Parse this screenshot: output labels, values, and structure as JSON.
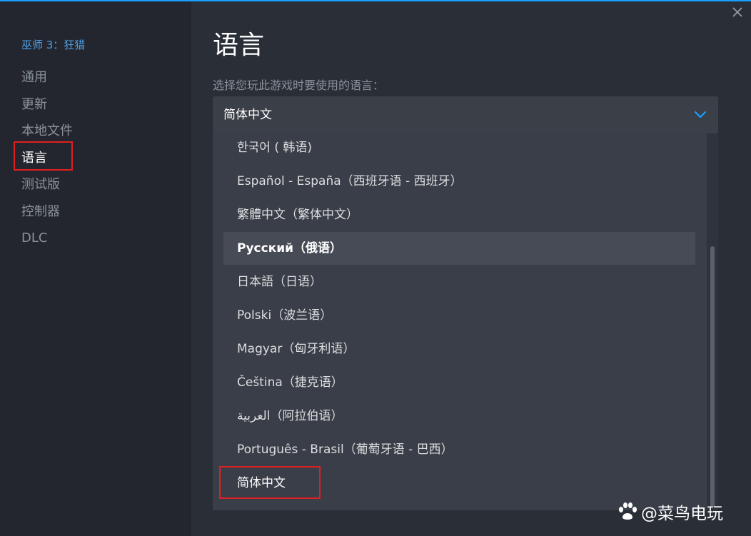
{
  "window": {
    "accent_color": "#1a9fff",
    "close_icon": "close-icon"
  },
  "sidebar": {
    "game_title": "巫师 3：狂猎",
    "items": [
      {
        "label": "通用"
      },
      {
        "label": "更新"
      },
      {
        "label": "本地文件"
      },
      {
        "label": "语言",
        "active": true
      },
      {
        "label": "测试版"
      },
      {
        "label": "控制器"
      },
      {
        "label": "DLC"
      }
    ]
  },
  "main": {
    "title": "语言",
    "subtitle": "选择您玩此游戏时要使用的语言：",
    "dropdown": {
      "selected": "简体中文",
      "icon": "chevron-down-icon",
      "options": [
        {
          "label": "한국어 ( 韩语)"
        },
        {
          "label": "Español - España（西班牙语 - 西班牙）"
        },
        {
          "label": "繁體中文（繁体中文）"
        },
        {
          "label": "Русский（俄语）",
          "hovered": true
        },
        {
          "label": "日本語（日语）"
        },
        {
          "label": "Polski（波兰语）"
        },
        {
          "label": "Magyar（匈牙利语）"
        },
        {
          "label": "Čeština（捷克语）"
        },
        {
          "label": "العربية（阿拉伯语）"
        },
        {
          "label": "Português - Brasil（葡萄牙语 - 巴西）"
        },
        {
          "label": "简体中文",
          "current": true
        }
      ]
    }
  },
  "annotation_color": "#e02020",
  "watermark": {
    "text": "@菜鸟电玩",
    "logo": "paw-logo"
  }
}
